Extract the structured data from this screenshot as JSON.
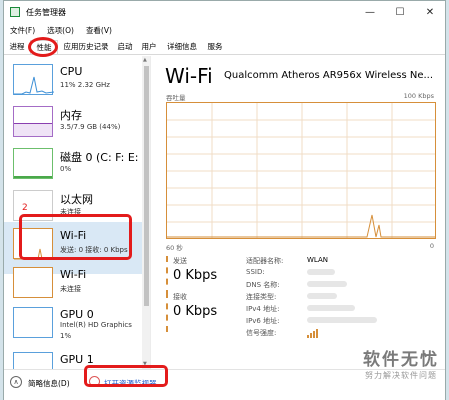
{
  "window": {
    "title": "任务管理器"
  },
  "window_controls": {
    "minimize": "—",
    "maximize": "☐",
    "close": "✕"
  },
  "menu": [
    "文件(F)",
    "选项(O)",
    "查看(V)"
  ],
  "tabs": [
    "进程",
    "性能",
    "应用历史记录",
    "启动",
    "用户",
    "详细信息",
    "服务"
  ],
  "active_tab": "性能",
  "resources": [
    {
      "name": "CPU",
      "sub1": "11% 2.32 GHz",
      "sub2": ""
    },
    {
      "name": "内存",
      "sub1": "3.5/7.9 GB (44%)",
      "sub2": ""
    },
    {
      "name": "磁盘 0 (C: F: E:",
      "sub1": "0%",
      "sub2": ""
    },
    {
      "name": "以太网",
      "sub1": "未连接",
      "sub2": ""
    },
    {
      "name": "Wi-Fi",
      "sub1": "发送: 0 接收: 0 Kbps",
      "sub2": ""
    },
    {
      "name": "Wi-Fi",
      "sub1": "未连接",
      "sub2": ""
    },
    {
      "name": "GPU 0",
      "sub1": "Intel(R) HD Graphics",
      "sub2": "1%"
    },
    {
      "name": "GPU 1",
      "sub1": "",
      "sub2": ""
    }
  ],
  "detail": {
    "title": "Wi-Fi",
    "adapter": "Qualcomm Atheros AR956x Wireless Ne...",
    "graph_label_left": "吞吐量",
    "graph_label_right": "100 Kbps",
    "graph_bottom_left": "60 秒",
    "graph_bottom_right": "0",
    "send_label": "发送",
    "send_value": "0 Kbps",
    "recv_label": "接收",
    "recv_value": "0 Kbps",
    "properties": [
      {
        "key": "适配器名称:",
        "value": "WLAN"
      },
      {
        "key": "SSID:",
        "value": ""
      },
      {
        "key": "DNS 名称:",
        "value": ""
      },
      {
        "key": "连接类型:",
        "value": ""
      },
      {
        "key": "IPv4 地址:",
        "value": ""
      },
      {
        "key": "IPv6 地址:",
        "value": ""
      },
      {
        "key": "信号强度:",
        "value": ""
      }
    ]
  },
  "bottom": {
    "brief": "简略信息(D)",
    "resource_monitor": "打开资源监视器"
  },
  "annotation": {
    "step_number": "2"
  },
  "watermark": {
    "main": "软件无忧",
    "sub": "努力解决软件问题"
  },
  "colors": {
    "network_accent": "#d68f3a",
    "cpu_accent": "#3c8fd6",
    "memory_accent": "#8a3fb0",
    "disk_accent": "#4aa84a",
    "annotation": "#e31b1b"
  }
}
